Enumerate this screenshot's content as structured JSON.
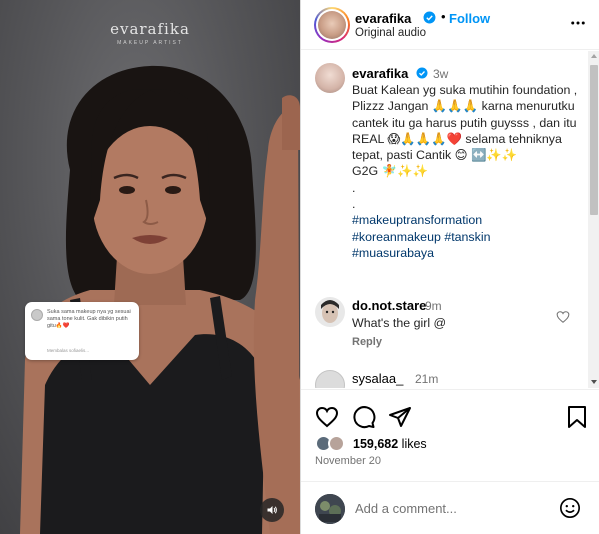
{
  "media": {
    "watermark": "evarafika",
    "watermark_sub": "MAKEUP ARTIST",
    "sticker": {
      "text": "Suka sama makeup nya yg sesuai sama tone kulit. Gak dibikin putih gitu🔥❤️",
      "reply": "Membalas sofiaelis..."
    }
  },
  "header": {
    "username": "evarafika",
    "separator": "•",
    "follow_label": "Follow",
    "audio": "Original audio"
  },
  "caption": {
    "username": "evarafika",
    "time": "3w",
    "text": "Buat Kalean yg suka mutihin foundation , Plizzz Jangan 🙏🙏🙏 karna menurutku cantek itu ga harus putih guysss , dan itu REAL 😱🙏🙏🙏❤️ selama tehniknya tepat, pasti Cantik 😊 ↔️✨✨\nG2G 🧚✨✨\n.\n.",
    "hashtags": [
      "#makeuptransformation",
      "#koreanmakeup",
      "#tanskin",
      "#muasurabaya"
    ]
  },
  "comments": [
    {
      "username": "do.not.stare",
      "time": "9m",
      "text": "What's the girl @",
      "reply_label": "Reply"
    },
    {
      "username": "sysalaa_",
      "time": "21m",
      "text": "",
      "reply_label": ""
    }
  ],
  "actions": {
    "likes_count": "159,682",
    "likes_suffix": " likes",
    "date": "November 20"
  },
  "add_comment": {
    "placeholder": "Add a comment..."
  },
  "colors": {
    "accent": "#0095f6",
    "verified": "#0095f6",
    "hashtag": "#00376b",
    "muted": "#737373"
  }
}
